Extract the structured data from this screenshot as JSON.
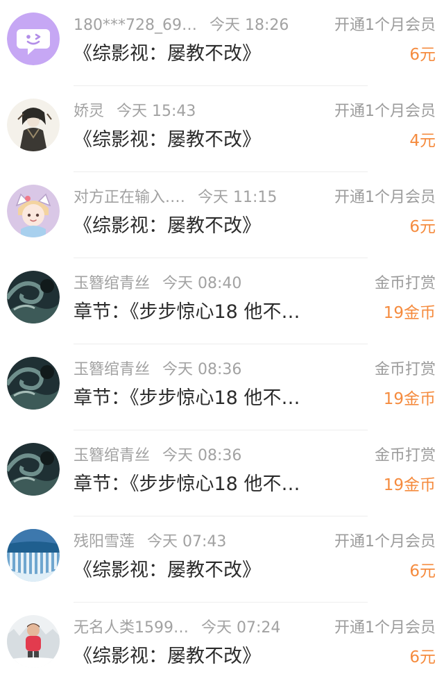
{
  "items": [
    {
      "user": "180***728_69…",
      "time": "今天 18:26",
      "type": "开通1个月会员",
      "title": "《综影视：屡教不改》",
      "amount": "6元",
      "avatar": "chat-bubble-icon"
    },
    {
      "user": "娇灵",
      "time": "今天 15:43",
      "type": "开通1个月会员",
      "title": "《综影视：屡教不改》",
      "amount": "4元",
      "avatar": "anime-character"
    },
    {
      "user": "对方正在输入.…",
      "time": "今天 11:15",
      "type": "开通1个月会员",
      "title": "《综影视：屡教不改》",
      "amount": "6元",
      "avatar": "cat-ear-girl"
    },
    {
      "user": "玉簪绾青丝",
      "time": "今天 08:40",
      "type": "金币打赏",
      "title": "章节：《步步惊心18  他不…",
      "amount": "19金币",
      "avatar": "ocean-wave"
    },
    {
      "user": "玉簪绾青丝",
      "time": "今天 08:36",
      "type": "金币打赏",
      "title": "章节：《步步惊心18  他不…",
      "amount": "19金币",
      "avatar": "ocean-wave"
    },
    {
      "user": "玉簪绾青丝",
      "time": "今天 08:36",
      "type": "金币打赏",
      "title": "章节：《步步惊心18  他不…",
      "amount": "19金币",
      "avatar": "ocean-wave"
    },
    {
      "user": "残阳雪莲",
      "time": "今天 07:43",
      "type": "开通1个月会员",
      "title": "《综影视：屡教不改》",
      "amount": "6元",
      "avatar": "waterfall"
    },
    {
      "user": "无名人类1599…",
      "time": "今天 07:24",
      "type": "开通1个月会员",
      "title": "《综影视：屡教不改》",
      "amount": "6元",
      "avatar": "child-in-snow"
    }
  ],
  "colors": {
    "amount": "#f58b3e",
    "meta": "#a2a2a2",
    "title": "#2b2b2b",
    "bubble_avatar_bg": "#c6a7f4"
  }
}
